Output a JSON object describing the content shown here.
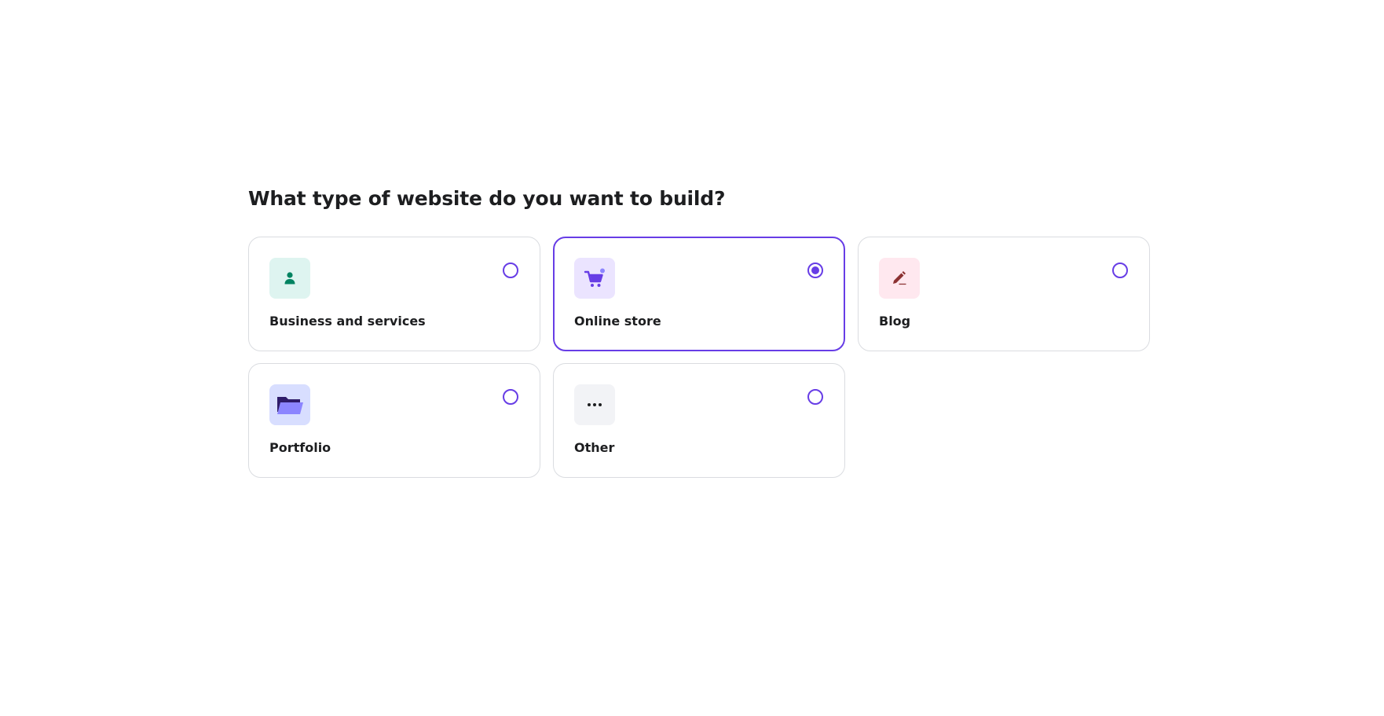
{
  "question": "What type of website do you want to build?",
  "options": [
    {
      "label": "Business and services",
      "icon": "person-icon",
      "tile_color": "#def4f0",
      "icon_color": "#008361",
      "selected": false
    },
    {
      "label": "Online store",
      "icon": "shopping-cart-icon",
      "tile_color": "#ebe4ff",
      "icon_color": "#673de6",
      "selected": true
    },
    {
      "label": "Blog",
      "icon": "pen-icon",
      "tile_color": "#ffe8ef",
      "icon_color": "#8c3232",
      "selected": false
    },
    {
      "label": "Portfolio",
      "icon": "folder-icon",
      "tile_color": "#d8deff",
      "icon_color": "#8c85ff",
      "selected": false
    },
    {
      "label": "Other",
      "icon": "more-dots-icon",
      "tile_color": "#f2f3f6",
      "icon_color": "#1d1e20",
      "selected": false
    }
  ],
  "colors": {
    "accent": "#673de6",
    "border": "#dadce0",
    "text": "#1d1e20"
  }
}
